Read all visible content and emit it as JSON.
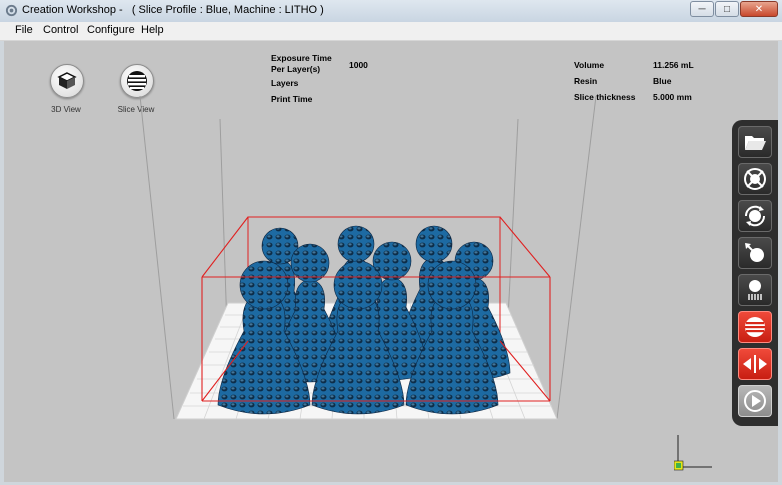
{
  "window": {
    "title": "Creation Workshop -   ( Slice Profile : Blue, Machine : LITHO )",
    "minimize_glyph": "─",
    "maximize_glyph": "□",
    "close_glyph": "✕"
  },
  "menu": [
    "File",
    "Control",
    "Configure",
    "Help"
  ],
  "views": {
    "view3d_label": "3D View",
    "slice_view_label": "Slice View"
  },
  "stats_left": {
    "exposure_label_1": "Exposure Time",
    "exposure_label_2": "Per Layer(s)",
    "exposure_value": "1000",
    "layers_label": "Layers",
    "print_time_label": "Print Time"
  },
  "stats_right": {
    "volume_label": "Volume",
    "volume_value": "11.256 mL",
    "resin_label": "Resin",
    "resin_value": "Blue",
    "slice_label": "Slice thickness",
    "slice_value": "5.000 mm"
  },
  "toolbar": {
    "items": [
      "open-file",
      "scale",
      "rotate",
      "move",
      "support",
      "slice",
      "mirror",
      "print"
    ]
  },
  "colors": {
    "model_blue": "#1f6fa8",
    "bounding_box": "#e02020",
    "active_tool": "#e02a1c",
    "toolbar_bg": "#2e2e2e",
    "viewport_bg": "#c4c4c4"
  }
}
